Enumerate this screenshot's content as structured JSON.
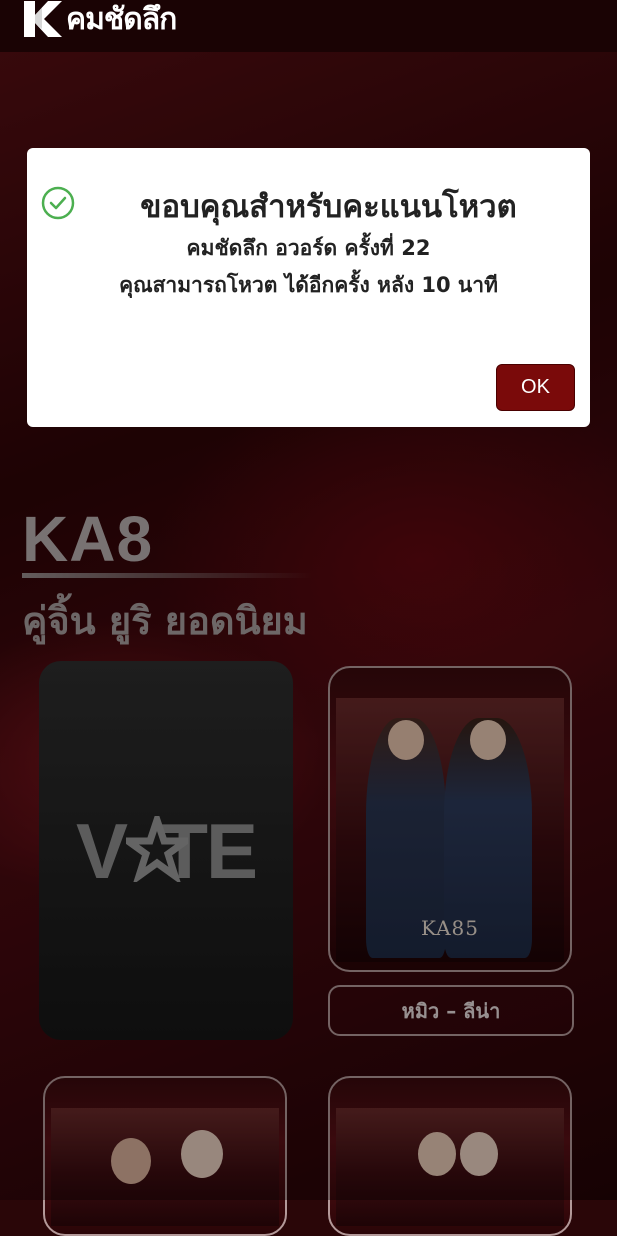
{
  "header": {
    "logo_text": "คมชัดลึก"
  },
  "modal": {
    "title": "ขอบคุณสำหรับคะแนนโหวต",
    "line1": "คมชัดลึก อวอร์ด ครั้งที่ 22",
    "line2": "คุณสามารถโหวต ได้อีกครั้ง หลัง 10 นาที",
    "ok_label": "OK",
    "icon": "check-circle-icon",
    "accent_color": "#7a0a0a",
    "check_color": "#4caf50"
  },
  "section": {
    "code": "KA8",
    "subtitle": "คู่จิ้น ยูริ ยอดนิยม"
  },
  "vote_card": {
    "label": "VOTE",
    "icon": "star-icon"
  },
  "candidates": [
    {
      "code": "KA85",
      "name": "หมิว – ลีน่า"
    },
    {
      "code": "",
      "name": ""
    },
    {
      "code": "",
      "name": ""
    }
  ]
}
